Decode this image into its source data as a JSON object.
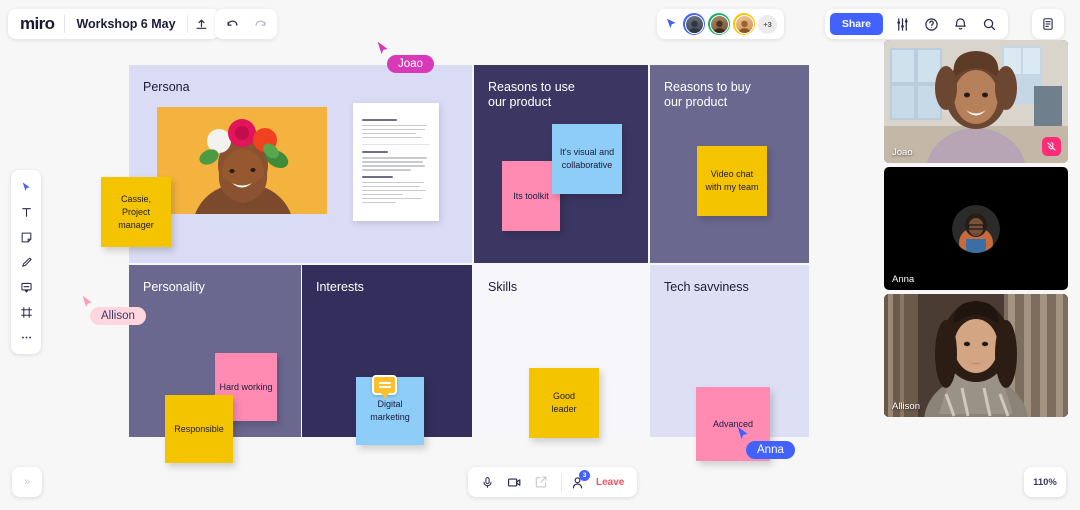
{
  "app": {
    "logo": "miro",
    "board_title": "Workshop 6 May",
    "zoom_level": "110%",
    "expand_label": "»"
  },
  "header": {
    "upload_icon": "upload-icon",
    "undo_icon": "undo-icon",
    "redo_icon": "redo-icon",
    "share_label": "Share",
    "avatar_overflow": "+3",
    "icons": {
      "cursor_share": "cursor-share-icon",
      "settings": "sliders-icon",
      "help": "question-circle-icon",
      "notifications": "bell-icon",
      "search": "search-icon",
      "panel": "notes-panel-icon"
    },
    "avatars": [
      {
        "name": "participant-1",
        "ring": "#4262ff",
        "skin": "#5b6270"
      },
      {
        "name": "participant-2",
        "ring": "#16b364",
        "skin": "#8a6a50"
      },
      {
        "name": "participant-3",
        "ring": "#ffc400",
        "skin": "#e8b888"
      }
    ]
  },
  "toolbar": {
    "items": [
      {
        "name": "select-tool",
        "icon": "cursor-icon",
        "active": true
      },
      {
        "name": "text-tool",
        "icon": "text-icon",
        "active": false
      },
      {
        "name": "sticky-note-tool",
        "icon": "sticky-note-icon",
        "active": false
      },
      {
        "name": "pen-tool",
        "icon": "pen-icon",
        "active": false
      },
      {
        "name": "comment-tool",
        "icon": "comment-icon",
        "active": false
      },
      {
        "name": "frame-tool",
        "icon": "frame-icon",
        "active": false
      },
      {
        "name": "more-tools",
        "icon": "ellipsis-icon",
        "active": false
      }
    ]
  },
  "board": {
    "quadrants": [
      {
        "id": "persona",
        "title": "Persona",
        "bg": "#dadcf5",
        "color": "#1b1b3a"
      },
      {
        "id": "reasons-use",
        "title": "Reasons to use\nour product",
        "bg": "#3c3663",
        "color": "#ffffff"
      },
      {
        "id": "reasons-buy",
        "title": "Reasons to buy\nour product",
        "bg": "#6b6890",
        "color": "#ffffff"
      },
      {
        "id": "personality",
        "title": "Personality",
        "bg": "#6b6890",
        "color": "#ffffff"
      },
      {
        "id": "interests",
        "title": "Interests",
        "bg": "#332e5c",
        "color": "#ffffff"
      },
      {
        "id": "skills",
        "title": "Skills",
        "bg": "#f7f7fb",
        "color": "#1b1b3a"
      },
      {
        "id": "tech-savviness",
        "title": "Tech savviness",
        "bg": "#dde0f4",
        "color": "#1b1b3a"
      }
    ],
    "stickies": [
      {
        "id": "cassie",
        "text": "Cassie,\nProject\nmanager",
        "color": "#f5c400"
      },
      {
        "id": "its-toolkit",
        "text": "Its toolkit",
        "color": "#ff8bb3"
      },
      {
        "id": "visual-collab",
        "text": "It's visual and\ncollaborative",
        "color": "#8ecdf7"
      },
      {
        "id": "video-chat",
        "text": "Video chat\nwith my team",
        "color": "#f5c400"
      },
      {
        "id": "hard-working",
        "text": "Hard working",
        "color": "#ff8bb3"
      },
      {
        "id": "responsible",
        "text": "Responsible",
        "color": "#f5c400"
      },
      {
        "id": "digital-marketing",
        "text": "Digital\nmarketing",
        "color": "#8ecdf7"
      },
      {
        "id": "good-leader",
        "text": "Good\nleader",
        "color": "#f5c400"
      },
      {
        "id": "advanced",
        "text": "Advanced",
        "color": "#ff8bb3"
      }
    ],
    "document_card": {
      "name": "research-document",
      "title": "Relative research"
    }
  },
  "cursors": [
    {
      "name": "Joao",
      "color": "#d739b8",
      "label_bg": "#d739b8",
      "label_color": "#ffffff"
    },
    {
      "name": "Allison",
      "color": "#ff9fb6",
      "label_bg": "#ffd5de",
      "label_color": "#3b3b63"
    },
    {
      "name": "Anna",
      "color": "#4262ff",
      "label_bg": "#4262ff",
      "label_color": "#ffffff"
    }
  ],
  "video_panel": {
    "tiles": [
      {
        "name": "Joao",
        "camera_on": true,
        "muted": true
      },
      {
        "name": "Anna",
        "camera_on": false,
        "muted": false
      },
      {
        "name": "Allison",
        "camera_on": true,
        "muted": false
      }
    ]
  },
  "call_bar": {
    "mic_icon": "microphone-icon",
    "camera_icon": "video-camera-icon",
    "share_screen_icon": "share-screen-icon",
    "participants_icon": "participants-icon",
    "participants_count": "3",
    "leave_label": "Leave"
  }
}
